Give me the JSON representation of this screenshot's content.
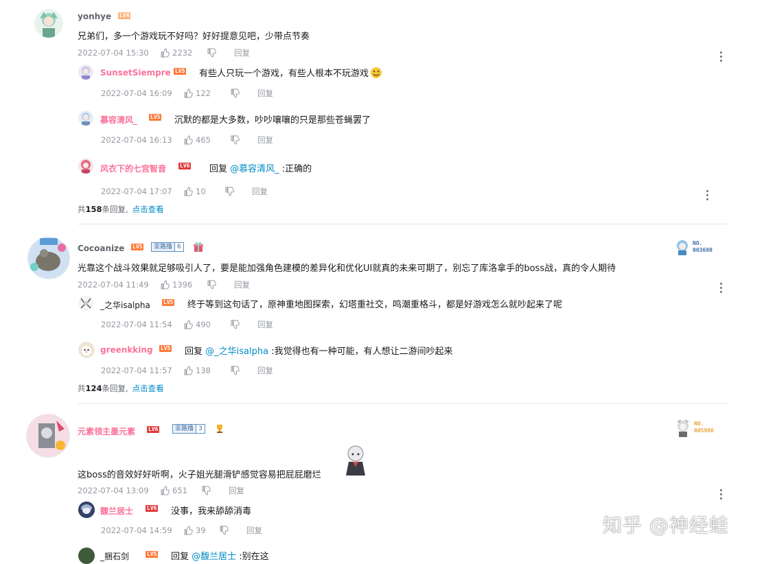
{
  "c1": {
    "user": "yonhye",
    "lv": "LV4",
    "text": "兄弟们，多一个游戏玩不好吗？好好提意见吧，少带点节奏",
    "time": "2022-07-04 15:30",
    "likes": "2232",
    "reply": "回复",
    "subs": [
      {
        "user": "SunsetSiempre",
        "lv": "LV5",
        "text": "有些人只玩一个游戏，有些人根本不玩游戏",
        "time": "2022-07-04 16:09",
        "likes": "122",
        "reply": "回复"
      },
      {
        "user": "慕容清风_",
        "lv": "LV5",
        "text": "沉默的都是大多数，吵吵嚷嚷的只是那些苍蝇罢了",
        "time": "2022-07-04 16:13",
        "likes": "465",
        "reply": "回复"
      },
      {
        "user": "风衣下的七宫智音",
        "lv": "LV6",
        "prefix": "回复 ",
        "mention": "@慕容清风_",
        "text": " :正确的",
        "time": "2022-07-04 17:07",
        "likes": "10",
        "reply": "回复"
      }
    ],
    "count_pre": "共",
    "count": "158",
    "count_post": "条回复,",
    "view_more": "点击查看"
  },
  "c2": {
    "user": "Cocoanize",
    "lv": "LV5",
    "fan_name": "亚路撸",
    "fan_level": "6",
    "badge_no": "NO.",
    "badge_num": "003690",
    "text": "光靠这个战斗效果就足够吸引人了，要是能加强角色建模的差异化和优化UI就真的未来可期了，别忘了库洛拿手的boss战，真的令人期待",
    "time": "2022-07-04 11:49",
    "likes": "1396",
    "reply": "回复",
    "subs": [
      {
        "user": "_之华isalpha",
        "lv": "LV5",
        "text": "终于等到这句话了，原神重地图探索，幻塔重社交，鸣潮重格斗，都是好游戏怎么就吵起来了呢",
        "time": "2022-07-04 11:54",
        "likes": "490",
        "reply": "回复"
      },
      {
        "user": "greenkking",
        "lv": "LV5",
        "prefix": "回复 ",
        "mention": "@_之华isalpha",
        "text": " :我觉得也有一种可能，有人想让二游间吵起来",
        "time": "2022-07-04 11:57",
        "likes": "138",
        "reply": "回复"
      }
    ],
    "count_pre": "共",
    "count": "124",
    "count_post": "条回复,",
    "view_more": "点击查看"
  },
  "c3": {
    "user": "元素领主墨元素",
    "lv": "LV6",
    "fan_name": "亚路撸",
    "fan_level": "3",
    "badge_no": "NO.",
    "badge_num": "005986",
    "text": "这boss的音效好好听啊，火子姐光腿滑铲感觉容易把屁屁磨烂",
    "time": "2022-07-04 13:09",
    "likes": "651",
    "reply": "回复",
    "subs": [
      {
        "user": "馥兰居士",
        "lv": "LV6",
        "text": "没事，我来舔舔消毒",
        "time": "2022-07-04 14:59",
        "likes": "39",
        "reply": "回复"
      },
      {
        "user": "_捆石剑",
        "lv": "LV5",
        "prefix": "回复 ",
        "mention": "@馥兰居士",
        "text": " :别在这",
        "time": "",
        "likes": "",
        "reply": ""
      }
    ]
  },
  "watermark": "知乎 @神经蛙",
  "colors": {
    "accent_pink": "#fb7299",
    "link": "#008ac5",
    "meta": "#9499a0"
  }
}
